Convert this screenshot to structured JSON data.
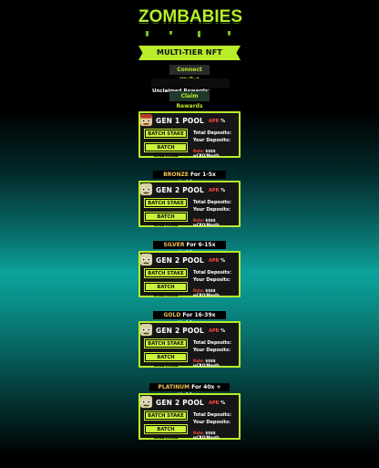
{
  "header": {
    "logo_text": "ZOMBABIES",
    "banner": "MULTI-TIER NFT STAKING",
    "connect_label": "Connect Wallet",
    "unclaimed_label": "Unclaimed Rewards:",
    "claim_label": "Claim Rewards"
  },
  "tiers": [
    {
      "tier": "BRONZE",
      "range": "For 1-5x Holders"
    },
    {
      "tier": "SILVER",
      "range": "For 6-15x Holders"
    },
    {
      "tier": "GOLD",
      "range": "For 16-39x Holders"
    },
    {
      "tier": "PLATINUM",
      "range": "For 40x + Holders"
    }
  ],
  "pools": [
    {
      "title": "GEN 1 POOL",
      "apr_label": "APR",
      "apr_suffix": "%",
      "stake_label": "BATCH STAKE",
      "unstake_label": "BATCH UNSTAKE",
      "total_label": "Total Deposits:",
      "your_label": "Your Deposits:",
      "rate_key": "Rate:",
      "rate_value": "$$$$ wCRO/Month"
    },
    {
      "title": "GEN 2 POOL",
      "apr_label": "APR",
      "apr_suffix": "%",
      "stake_label": "BATCH STAKE",
      "unstake_label": "BATCH UNSTAKE",
      "total_label": "Total Deposits:",
      "your_label": "Your Deposits:",
      "rate_key": "Rate:",
      "rate_value": "$$$$ wCRO/Month"
    },
    {
      "title": "GEN 2 POOL",
      "apr_label": "APR",
      "apr_suffix": "%",
      "stake_label": "BATCH STAKE",
      "unstake_label": "BATCH UNSTAKE",
      "total_label": "Total Deposits:",
      "your_label": "Your Deposits:",
      "rate_key": "Rate:",
      "rate_value": "$$$$ wCRO/Month"
    },
    {
      "title": "GEN 2 POOL",
      "apr_label": "APR",
      "apr_suffix": "%",
      "stake_label": "BATCH STAKE",
      "unstake_label": "BATCH UNSTAKE",
      "total_label": "Total Deposits:",
      "your_label": "Your Deposits:",
      "rate_key": "Rate:",
      "rate_value": "$$$$ wCRO/Month"
    },
    {
      "title": "GEN 2 POOL",
      "apr_label": "APR",
      "apr_suffix": "%",
      "stake_label": "BATCH STAKE",
      "unstake_label": "BATCH UNSTAKE",
      "total_label": "Total Deposits:",
      "your_label": "Your Deposits:",
      "rate_key": "Rate:",
      "rate_value": "$$$$ wCRO/Month"
    }
  ],
  "colors": {
    "accent": "#b9ec2a",
    "apr": "#ff4b3e",
    "tier": "#f0c35a"
  },
  "icons": {
    "avatar": "zombie-baby-avatar-icon"
  }
}
